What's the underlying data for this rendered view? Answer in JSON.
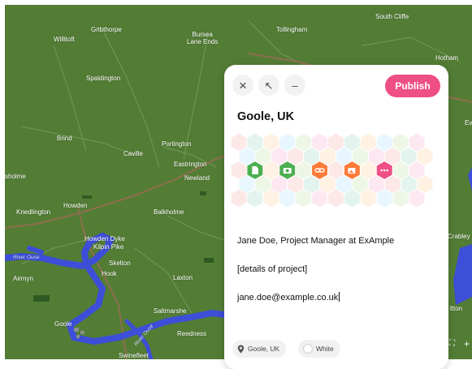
{
  "map": {
    "places": [
      {
        "id": "south-cliffe",
        "label": "South Cliffe"
      },
      {
        "id": "gribthorpe",
        "label": "Gribthorpe"
      },
      {
        "id": "bursea",
        "label": "Bursea\nLane Ends"
      },
      {
        "id": "tollingham",
        "label": "Tollingham"
      },
      {
        "id": "willitoft",
        "label": "Willitoft"
      },
      {
        "id": "hotham",
        "label": "Hotham"
      },
      {
        "id": "spaldington",
        "label": "Spaldington"
      },
      {
        "id": "brind",
        "label": "Brind"
      },
      {
        "id": "portington",
        "label": "Portington"
      },
      {
        "id": "caville",
        "label": "Caville"
      },
      {
        "id": "eastrington",
        "label": "Eastrington"
      },
      {
        "id": "newland",
        "label": "Newland"
      },
      {
        "id": "sholme",
        "label": "sholme"
      },
      {
        "id": "howden",
        "label": "Howden"
      },
      {
        "id": "knedlington",
        "label": "Knedlington"
      },
      {
        "id": "balkholme",
        "label": "Balkholme"
      },
      {
        "id": "howden-dyke",
        "label": "Howden Dyke"
      },
      {
        "id": "kilpin-pike",
        "label": "Kilpin Pike"
      },
      {
        "id": "skelton",
        "label": "Skelton"
      },
      {
        "id": "airmyn",
        "label": "Airmyn"
      },
      {
        "id": "hook",
        "label": "Hook"
      },
      {
        "id": "laxton",
        "label": "Laxton"
      },
      {
        "id": "saltmarshe",
        "label": "Saltmarshe"
      },
      {
        "id": "goole",
        "label": "Goole"
      },
      {
        "id": "reedness",
        "label": "Reedness"
      },
      {
        "id": "swinefleet",
        "label": "Swinefleet"
      },
      {
        "id": "crabley",
        "label": "Crabley"
      },
      {
        "id": "ittton",
        "label": "ltton"
      },
      {
        "id": "ev",
        "label": "Ev"
      }
    ],
    "rivers": [
      {
        "id": "river-ouse-west",
        "label": "River Ouse"
      },
      {
        "id": "river-ouse-east",
        "label": "River Ouse"
      }
    ],
    "controls": {
      "fullscreen": "⛶",
      "zoom_in": "+"
    }
  },
  "panel": {
    "toolbar": {
      "close": "×",
      "expand": "↖",
      "minimize": "–",
      "publish_label": "Publish"
    },
    "location_title": "Goole, UK",
    "hex_icons": [
      {
        "name": "document-icon",
        "color": "#4caf50"
      },
      {
        "name": "camera-icon",
        "color": "#4caf50"
      },
      {
        "name": "link-icon",
        "color": "#ff7b3a"
      },
      {
        "name": "image-icon",
        "color": "#ff7b3a"
      },
      {
        "name": "more-icon",
        "color": "#ee4f86"
      }
    ],
    "lines": {
      "name": "Jane Doe, Project Manager at ExAmple",
      "details": "[details of project]",
      "email": "jane.doe@example.co.uk"
    },
    "chips": {
      "location": "Goole, UK",
      "color": "White"
    }
  }
}
